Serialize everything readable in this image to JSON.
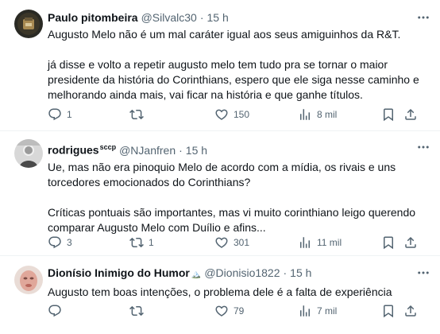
{
  "tweets": [
    {
      "author": "Paulo pitombeira",
      "badge": "",
      "handle": "@Silvalc30",
      "time": "15 h",
      "paragraphs": [
        "Augusto Melo não é um mal caráter igual aos seus amiguinhos da R&T.",
        "já disse e volto a repetir augusto melo tem tudo pra se tornar o maior presidente da história do Corinthians, espero que ele siga nesse caminho e melhorando ainda mais, vai ficar na história e que ganhe títulos."
      ],
      "replies": "1",
      "retweets": "",
      "likes": "150",
      "views": "8 mil"
    },
    {
      "author": "rodrigues",
      "badge": "sccp",
      "handle": "@NJanfren",
      "time": "15 h",
      "paragraphs": [
        "Ue, mas não era pinoquio Melo de acordo com a mídia, os rivais e uns torcedores emocionados do Corinthians?",
        "Críticas pontuais são importantes, mas vi muito corinthiano leigo querendo comparar Augusto Melo com Duílio e afins..."
      ],
      "replies": "3",
      "retweets": "1",
      "likes": "301",
      "views": "11 mil"
    },
    {
      "author": "Dionísio Inimigo do Humor",
      "badge": "",
      "handle": "@Dionisio1822",
      "time": "15 h",
      "paragraphs": [
        "Augusto tem boas intenções, o problema dele é a falta de experiência"
      ],
      "replies": "",
      "retweets": "",
      "likes": "79",
      "views": "7 mil"
    }
  ],
  "icons": {
    "reply": "reply-icon",
    "retweet": "retweet-icon",
    "like": "like-icon",
    "views": "views-icon",
    "bookmark": "bookmark-icon",
    "share": "share-icon",
    "more": "more-icon"
  },
  "colors": {
    "text": "#0f1419",
    "secondary": "#536471",
    "divider": "#eff3f4"
  }
}
